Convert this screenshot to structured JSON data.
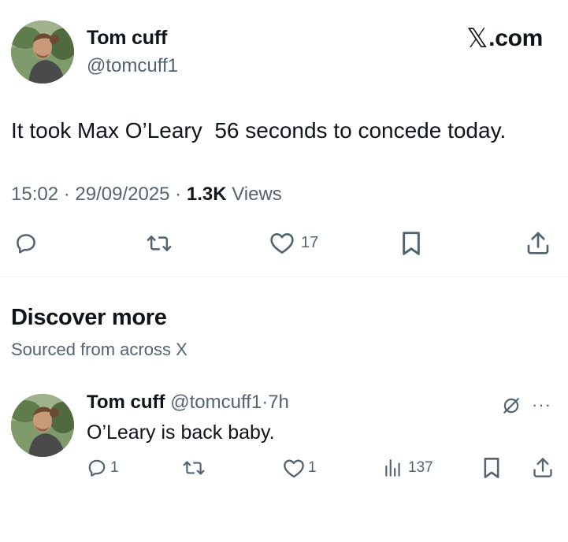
{
  "tweet": {
    "author_name": "Tom cuff",
    "handle": "@tomcuff1",
    "text": "It took Max O’Leary  56 seconds to concede today.",
    "time": "15:02",
    "date": "29/09/2025",
    "views_count": "1.3K",
    "views_label": "Views",
    "likes": "17",
    "icons": [
      "reply-icon",
      "retweet-icon",
      "like-icon",
      "bookmark-icon",
      "share-icon"
    ]
  },
  "brand": {
    "x_glyph": "𝕏",
    "domain": ".com"
  },
  "discover": {
    "title": "Discover more",
    "subtitle": "Sourced from across X"
  },
  "reply_tweet": {
    "author_name": "Tom cuff",
    "handle": "@tomcuff1",
    "separator": "·",
    "time": "7h",
    "text": "O’Leary is back baby.",
    "replies": "1",
    "likes": "1",
    "views": "137",
    "more": "···",
    "icons": [
      "reply-icon",
      "retweet-icon",
      "like-icon",
      "views-icon",
      "bookmark-icon",
      "share-icon",
      "grok-icon",
      "more-icon"
    ]
  },
  "colors": {
    "text_primary": "#0f1419",
    "text_secondary": "#536471",
    "divider": "#eff3f4"
  }
}
